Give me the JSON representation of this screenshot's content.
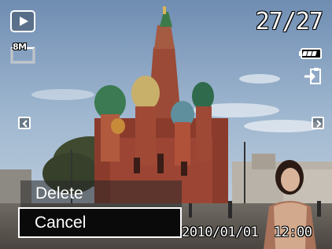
{
  "playback": {
    "mode_icon": "play-icon",
    "counter": "27/27",
    "resolution_label": "8M",
    "battery_icon": "battery-icon",
    "protect_icon": "protect-icon"
  },
  "navigation": {
    "prev_icon": "chevron-left-icon",
    "next_icon": "chevron-right-icon"
  },
  "menu": {
    "items": [
      {
        "label": "Delete"
      },
      {
        "label": "Cancel",
        "selected": true
      }
    ]
  },
  "photo_info": {
    "datetime": "2010/01/01  12:00"
  }
}
